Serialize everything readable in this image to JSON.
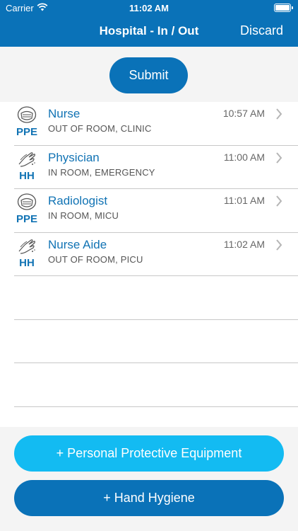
{
  "status_bar": {
    "carrier": "Carrier",
    "time": "11:02 AM"
  },
  "nav": {
    "title": "Hospital - In / Out",
    "discard_label": "Discard"
  },
  "submit_label": "Submit",
  "entries": [
    {
      "icon": "mask-icon",
      "code": "PPE",
      "role": "Nurse",
      "detail": "OUT OF ROOM, CLINIC",
      "time": "10:57 AM"
    },
    {
      "icon": "hands-icon",
      "code": "HH",
      "role": "Physician",
      "detail": "IN ROOM, EMERGENCY",
      "time": "11:00 AM"
    },
    {
      "icon": "mask-icon",
      "code": "PPE",
      "role": "Radiologist",
      "detail": "IN ROOM, MICU",
      "time": "11:01 AM"
    },
    {
      "icon": "hands-icon",
      "code": "HH",
      "role": "Nurse Aide",
      "detail": "OUT OF ROOM, PICU",
      "time": "11:02 AM"
    }
  ],
  "buttons": {
    "ppe_label": "+ Personal Protective Equipment",
    "hh_label": "+ Hand Hygiene"
  },
  "colors": {
    "primary": "#0a72b8",
    "accent": "#13bbf2",
    "text_blue": "#1173b4"
  }
}
